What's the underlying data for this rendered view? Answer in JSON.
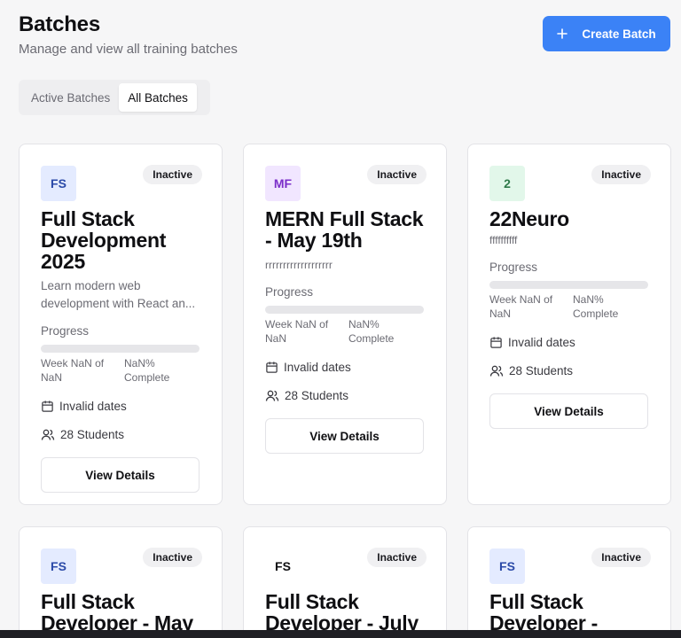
{
  "header": {
    "title": "Batches",
    "subtitle": "Manage and view all training batches",
    "create_label": "Create Batch"
  },
  "tabs": [
    {
      "label": "Active Batches",
      "active": false
    },
    {
      "label": "All Batches",
      "active": true
    }
  ],
  "colors": {
    "accent": "#3b82f6",
    "avatar_blue_bg": "#e4ebff",
    "avatar_blue_fg": "#2b4aa8",
    "avatar_purple_bg": "#f1e6ff",
    "avatar_purple_fg": "#7b2fc9",
    "avatar_green_bg": "#e2f7ea",
    "avatar_green_fg": "#2f7a4a"
  },
  "cards": [
    {
      "initials": "FS",
      "status": "Inactive",
      "title": "Full Stack Development 2025",
      "description": "Learn modern web development with React an...",
      "progress_label": "Progress",
      "progress_percent": 0,
      "week_text": "Week NaN of NaN",
      "complete_text": "NaN% Complete",
      "dates_text": "Invalid dates",
      "students_text": "28 Students",
      "button_label": "View Details"
    },
    {
      "initials": "MF",
      "status": "Inactive",
      "title": "MERN Full Stack - May 19th",
      "description": "rrrrrrrrrrrrrrrrrrr",
      "progress_label": "Progress",
      "progress_percent": 0,
      "week_text": "Week NaN of NaN",
      "complete_text": "NaN% Complete",
      "dates_text": "Invalid dates",
      "students_text": "28 Students",
      "button_label": "View Details"
    },
    {
      "initials": "2",
      "status": "Inactive",
      "title": "22Neuro",
      "description": "ffffffffff",
      "progress_label": "Progress",
      "progress_percent": 0,
      "week_text": "Week NaN of NaN",
      "complete_text": "NaN% Complete",
      "dates_text": "Invalid dates",
      "students_text": "28 Students",
      "button_label": "View Details"
    },
    {
      "initials": "FS",
      "status": "Inactive",
      "title": "Full Stack Developer - May"
    },
    {
      "initials": "FS",
      "status": "Inactive",
      "title": "Full Stack Developer - July"
    },
    {
      "initials": "FS",
      "status": "Inactive",
      "title": "Full Stack Developer -"
    }
  ]
}
